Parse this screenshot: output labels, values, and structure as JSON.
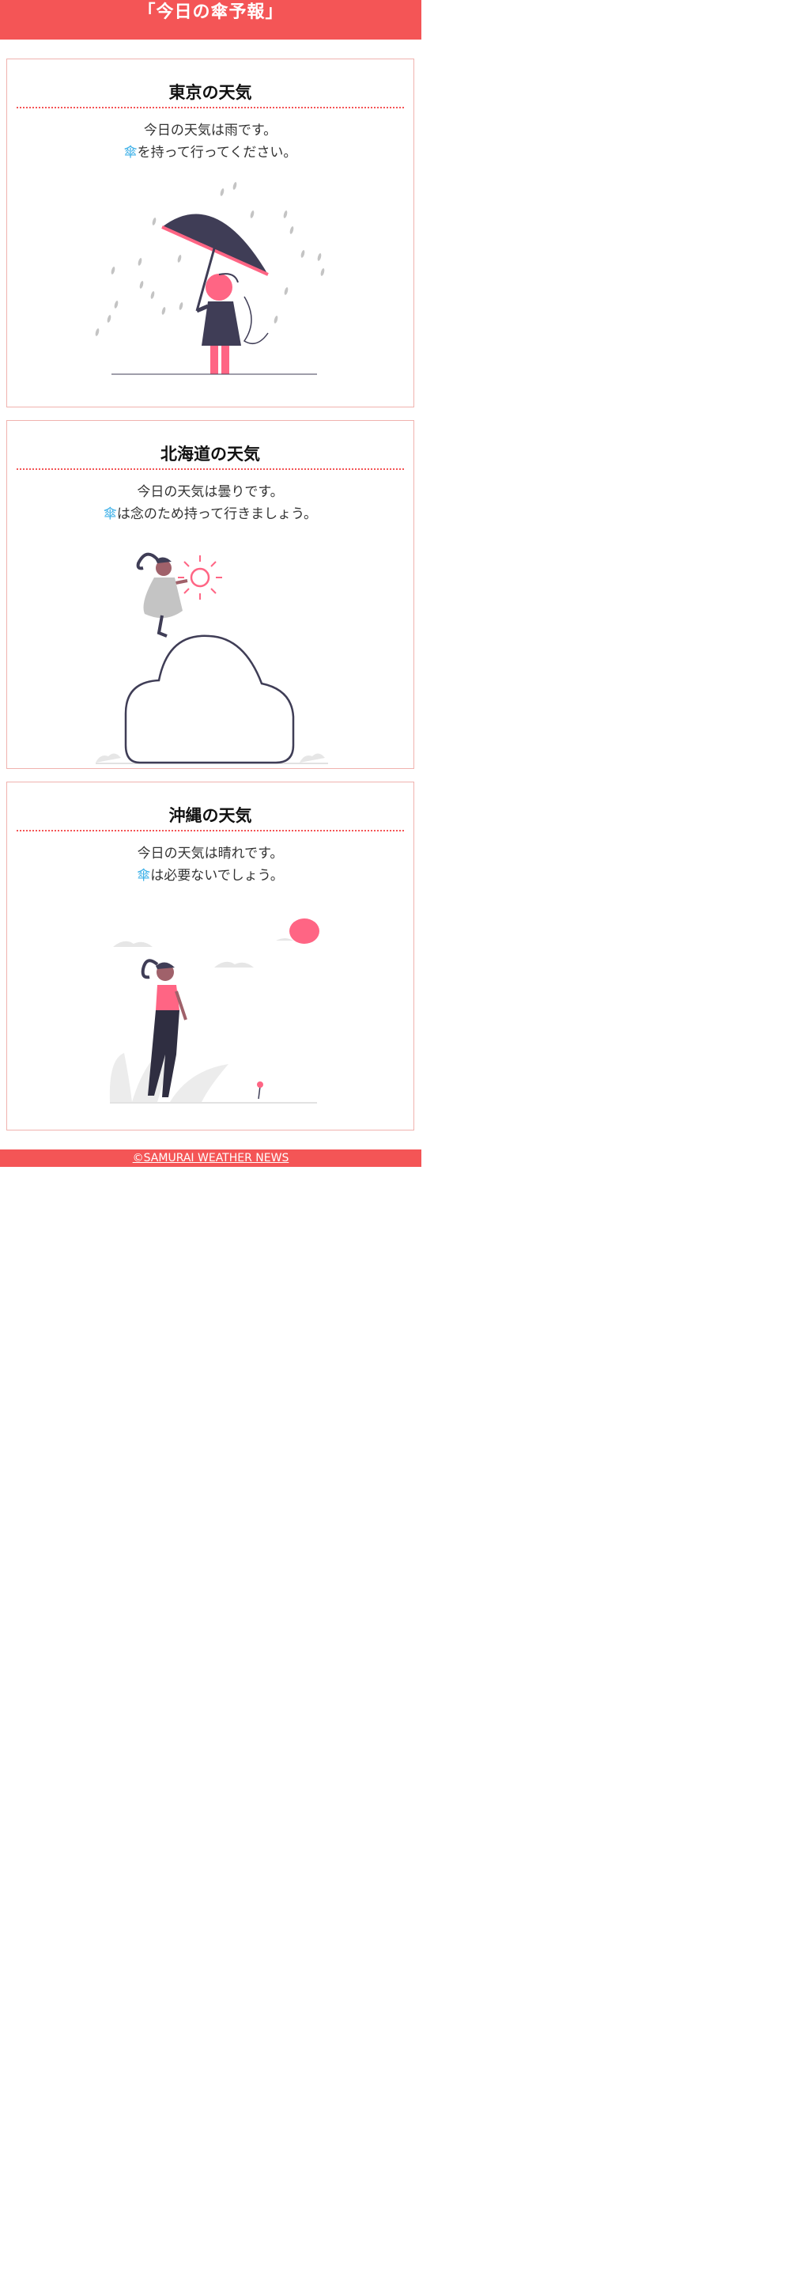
{
  "header": {
    "title": "「今日の傘予報」"
  },
  "cards": [
    {
      "title": "東京の天気",
      "line1": "今日の天気は雨です。",
      "umbrella": "傘",
      "line2_rest": "を持って行ってください。",
      "illustration": "woman-with-umbrella-in-rain"
    },
    {
      "title": "北海道の天気",
      "line1": "今日の天気は曇りです。",
      "umbrella": "傘",
      "line2_rest": "は念のため持って行きましょう。",
      "illustration": "woman-on-cloud-with-sun"
    },
    {
      "title": "沖縄の天気",
      "line1": "今日の天気は晴れです。",
      "umbrella": "傘",
      "line2_rest": "は必要ないでしょう。",
      "illustration": "woman-walking-sunny-day"
    }
  ],
  "footer": {
    "copyright": "©SAMURAI WEATHER NEWS"
  },
  "colors": {
    "accent": "#f45556",
    "card_border": "#f0b2ae",
    "umbrella_text": "#3fb1e8",
    "illustration_pink": "#ff6584",
    "illustration_dark": "#3f3d56"
  }
}
